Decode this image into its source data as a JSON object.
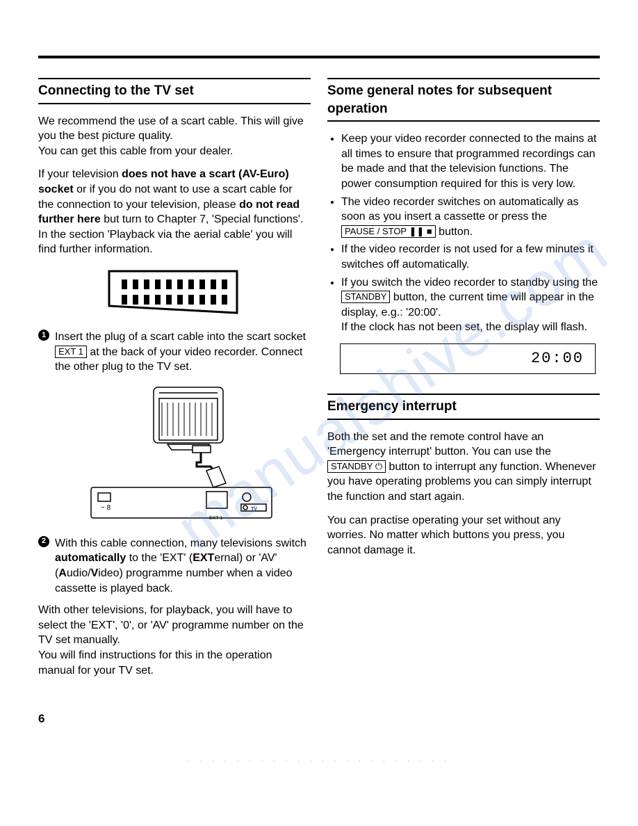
{
  "page_number": "6",
  "watermark": "manualshive.com",
  "left": {
    "heading": "Connecting to the TV set",
    "p1_a": "We recommend the use of a scart cable. This will give you the best picture quality.",
    "p1_b": "You can get this cable from your dealer.",
    "p2_pre": "If your television ",
    "p2_b1": "does not have a scart (AV-Euro) socket",
    "p2_mid": " or if you do not want to use a scart cable for the connection to your television, please ",
    "p2_b2": "do not read further here",
    "p2_post": " but turn to Chapter 7, 'Special functions'. In the section 'Playback via the aerial cable' you will find further information.",
    "step1_pre": "Insert the plug of a scart cable into the scart socket ",
    "step1_btn": "EXT 1",
    "step1_post": " at the back of your video recorder. Connect the other plug to the TV set.",
    "step2_pre": "With this cable connection, many televisions switch ",
    "step2_b1": "automatically",
    "step2_mid1": " to the 'EXT' (",
    "step2_b2": "EXT",
    "step2_mid2": "ernal) or 'AV' (",
    "step2_b3": "A",
    "step2_mid3": "udio/",
    "step2_b4": "V",
    "step2_mid4": "ideo) programme number when a video cassette is played back.",
    "p3_a": "With other televisions, for playback, you will have to select the 'EXT', '0', or 'AV' programme number on the TV set manually.",
    "p3_b": "You will find instructions for this in the operation manual for your TV set."
  },
  "right": {
    "heading1": "Some general notes for subsequent operation",
    "b1": "Keep your video recorder connected to the mains at all times to ensure that programmed recordings can be made and that the television functions. The power consumption required for this is very low.",
    "b2_pre": "The video recorder switches on automatically as soon as you insert a cassette or press the ",
    "b2_btn": "PAUSE / STOP ❚❚ ■",
    "b2_post": " button.",
    "b3": "If the video recorder is not used for a few minutes it switches off automatically.",
    "b4_pre": "If you switch the video recorder to standby using the ",
    "b4_btn": "STANDBY",
    "b4_post": " button, the current time will appear in the display, e.g.: '20:00'.",
    "b4_extra": "If the clock has not been set, the display will flash.",
    "display_value": "20:00",
    "heading2": "Emergency interrupt",
    "e_p1_pre": "Both the set and the remote control have an 'Emergency interrupt' button. You can use the ",
    "e_btn": "STANDBY ⏻",
    "e_p1_post": " button to interrupt any function. Whenever you have operating problems you can simply interrupt the function and start again.",
    "e_p2": "You can practise operating your set without any worries. No matter which buttons you press, you cannot damage it."
  }
}
